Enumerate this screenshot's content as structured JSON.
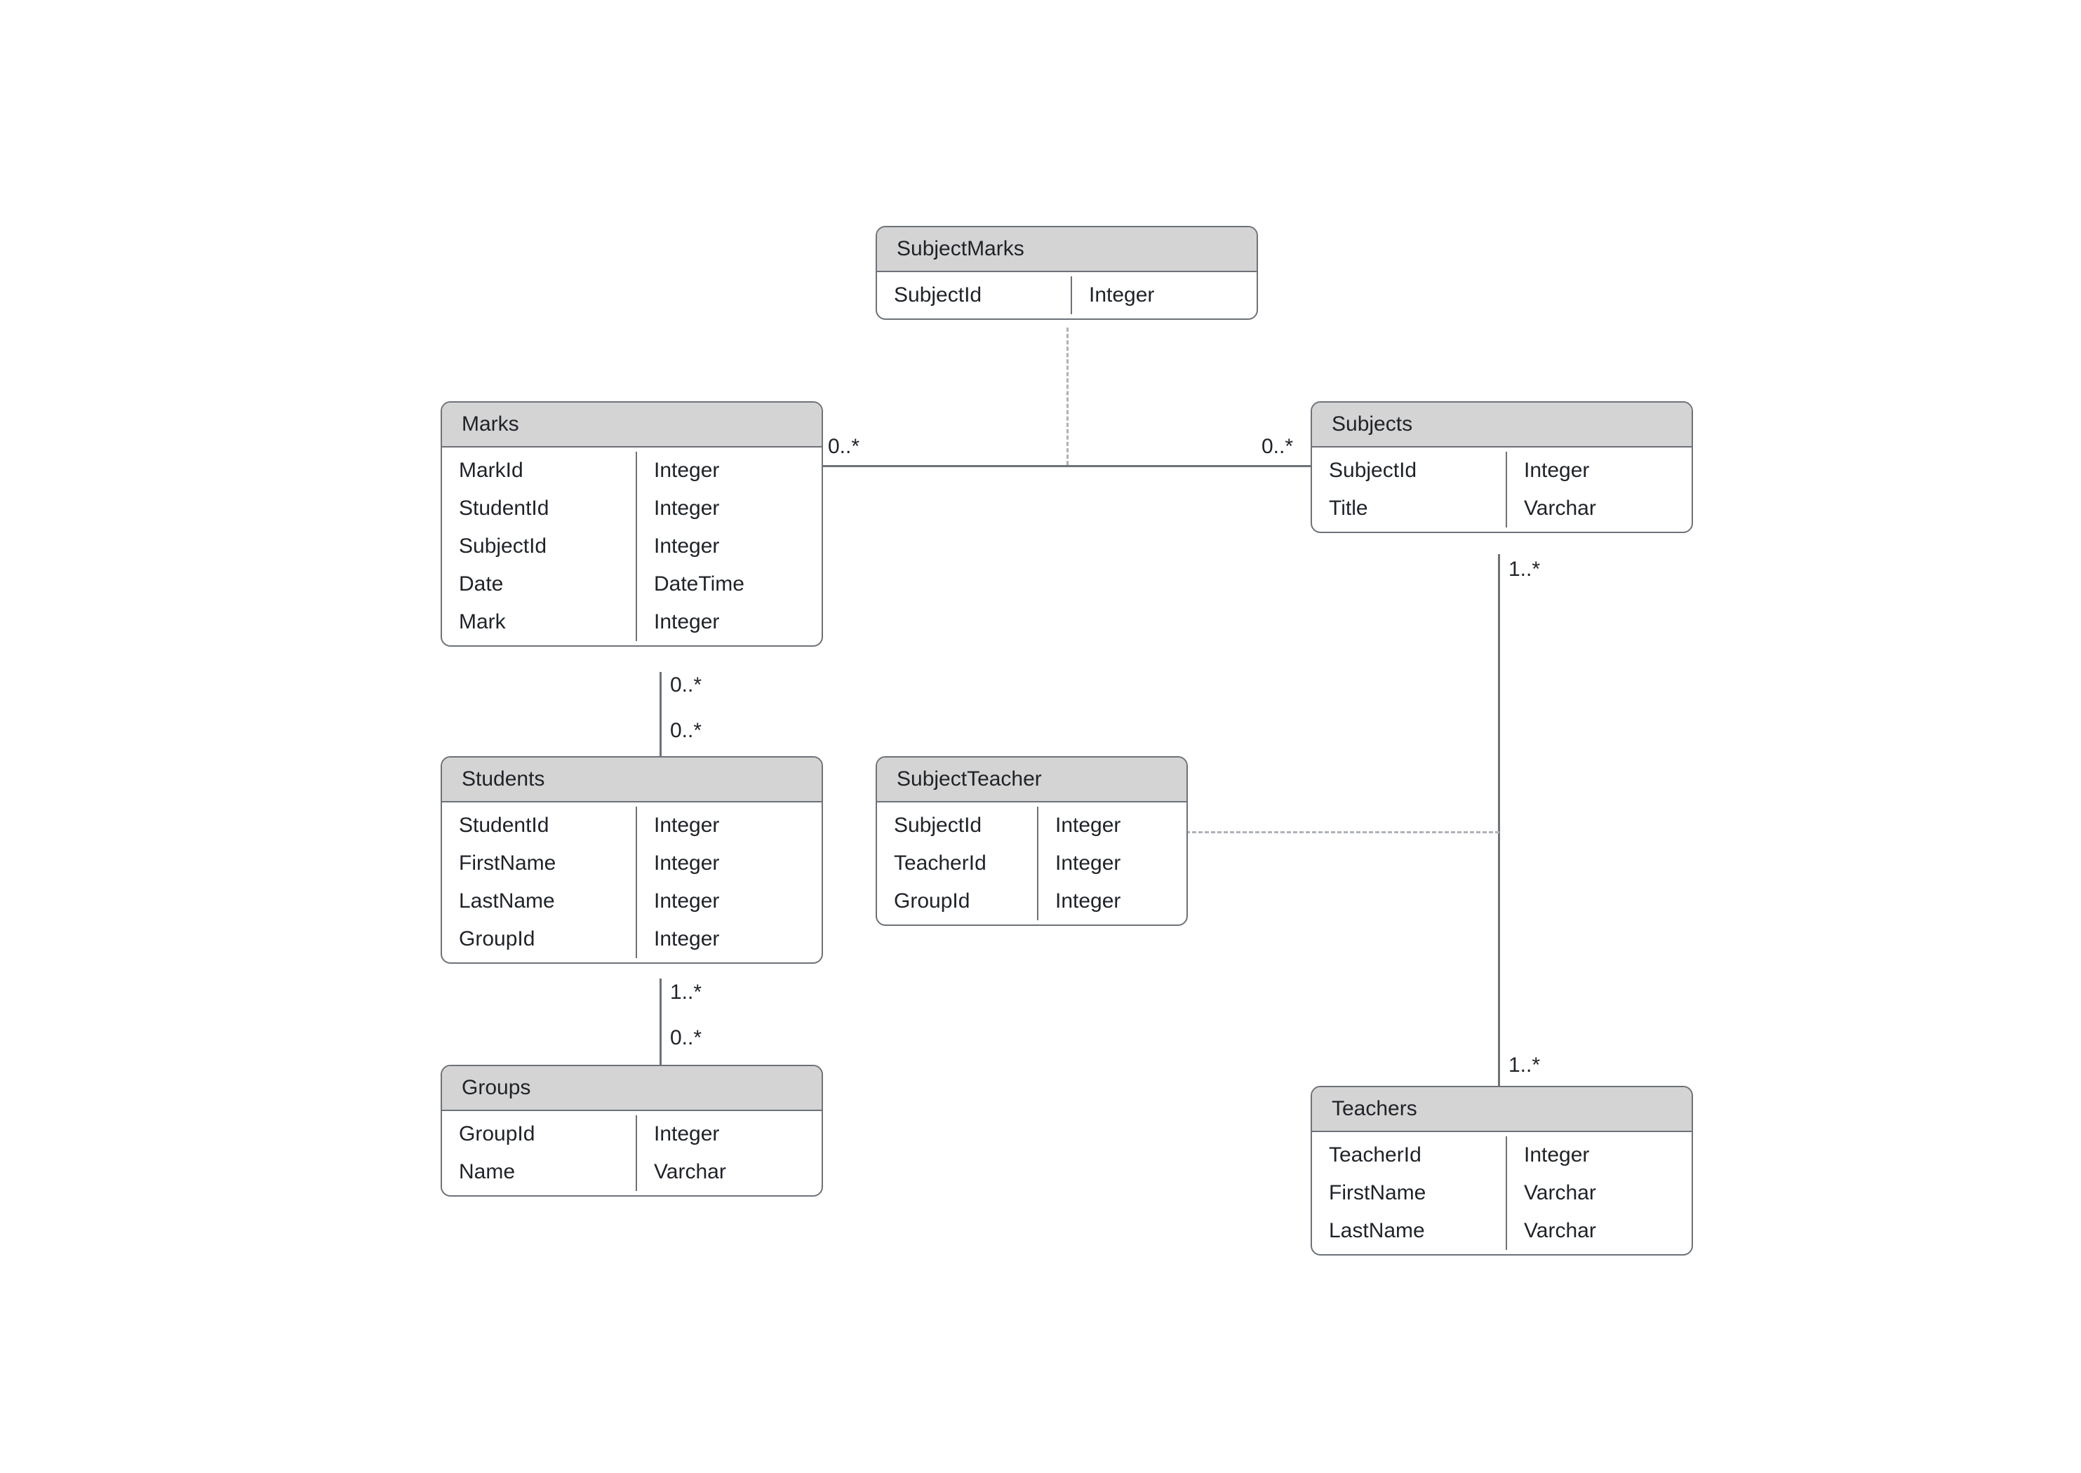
{
  "entities": {
    "subjectMarks": {
      "title": "SubjectMarks",
      "rows": [
        {
          "name": "SubjectId",
          "type": "Integer"
        }
      ]
    },
    "marks": {
      "title": "Marks",
      "rows": [
        {
          "name": "MarkId",
          "type": "Integer"
        },
        {
          "name": "StudentId",
          "type": "Integer"
        },
        {
          "name": "SubjectId",
          "type": "Integer"
        },
        {
          "name": "Date",
          "type": "DateTime"
        },
        {
          "name": "Mark",
          "type": "Integer"
        }
      ]
    },
    "subjects": {
      "title": "Subjects",
      "rows": [
        {
          "name": "SubjectId",
          "type": "Integer"
        },
        {
          "name": "Title",
          "type": "Varchar"
        }
      ]
    },
    "students": {
      "title": "Students",
      "rows": [
        {
          "name": "StudentId",
          "type": "Integer"
        },
        {
          "name": "FirstName",
          "type": "Integer"
        },
        {
          "name": "LastName",
          "type": "Integer"
        },
        {
          "name": "GroupId",
          "type": "Integer"
        }
      ]
    },
    "subjectTeacher": {
      "title": "SubjectTeacher",
      "rows": [
        {
          "name": "SubjectId",
          "type": "Integer"
        },
        {
          "name": "TeacherId",
          "type": "Integer"
        },
        {
          "name": "GroupId",
          "type": "Integer"
        }
      ]
    },
    "groups": {
      "title": "Groups",
      "rows": [
        {
          "name": "GroupId",
          "type": "Integer"
        },
        {
          "name": "Name",
          "type": "Varchar"
        }
      ]
    },
    "teachers": {
      "title": "Teachers",
      "rows": [
        {
          "name": "TeacherId",
          "type": "Integer"
        },
        {
          "name": "FirstName",
          "type": "Varchar"
        },
        {
          "name": "LastName",
          "type": "Varchar"
        }
      ]
    }
  },
  "multiplicities": {
    "marks_subjects_left": "0..*",
    "marks_subjects_right": "0..*",
    "subjects_teachers_top": "1..*",
    "subjects_teachers_bottom": "1..*",
    "marks_students_top": "0..*",
    "marks_students_bottom": "0..*",
    "students_groups_top": "1..*",
    "students_groups_bottom": "0..*"
  }
}
